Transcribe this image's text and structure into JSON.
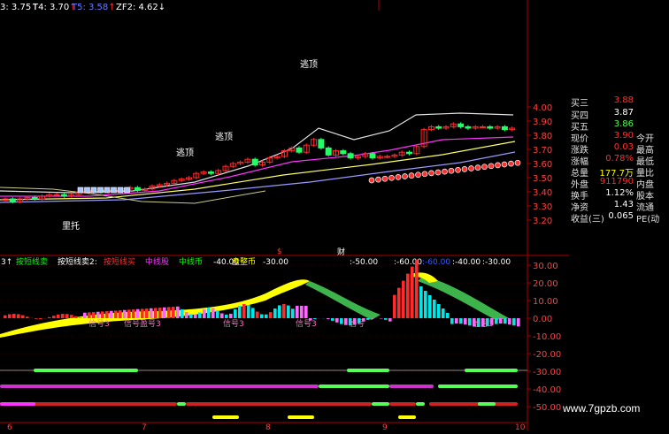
{
  "top_indicators": [
    {
      "text": "3: 3.75",
      "arrow": "↑",
      "color": "#ffffff",
      "arrow_color": "#ff3030"
    },
    {
      "text": "T4: 3.70",
      "arrow": "↑",
      "color": "#ffffff",
      "arrow_color": "#ff3030"
    },
    {
      "text": "T5: 3.58",
      "arrow": "↑",
      "color": "#6a7cff",
      "arrow_color": "#ff3030"
    },
    {
      "text": "ZF2: 4.62",
      "arrow": "↓",
      "color": "#ffffff",
      "arrow_color": "#ffffff"
    }
  ],
  "price_axis": [
    "4.00",
    "3.90",
    "3.80",
    "3.70",
    "3.60",
    "3.50",
    "3.40",
    "3.30",
    "3.20"
  ],
  "annotations": {
    "escape_top_1": "逃顶",
    "escape_top_2": "逃顶",
    "escape_top_3": "逃顶",
    "support": "里托"
  },
  "quote_panel": [
    {
      "label": "买三",
      "value": "3.88",
      "value_color": "#ff3030",
      "label2": ""
    },
    {
      "label": "买四",
      "value": "3.87",
      "value_color": "#ffffff",
      "label2": ""
    },
    {
      "label": "买五",
      "value": "3.86",
      "value_color": "#4cff4c",
      "label2": ""
    },
    {
      "label": "现价",
      "value": "3.90",
      "value_color": "#ff3030",
      "label2": "今开"
    },
    {
      "label": "涨跌",
      "value": "0.03",
      "value_color": "#ff3030",
      "label2": "最高"
    },
    {
      "label": "涨幅",
      "value": "0.78%",
      "value_color": "#ff3030",
      "label2": "最低"
    },
    {
      "label": "总量",
      "value": "177.7万",
      "value_color": "#ffff00",
      "label2": "量比"
    },
    {
      "label": "外盘",
      "value": "911790",
      "value_color": "#ff3030",
      "label2": "内盘"
    },
    {
      "label": "换手",
      "value": "1.12%",
      "value_color": "#ffffff",
      "label2": "股本"
    },
    {
      "label": "净资",
      "value": "1.43",
      "value_color": "#ffffff",
      "label2": "流通"
    },
    {
      "label": "收益(三)",
      "value": "0.065",
      "value_color": "#ffffff",
      "label2": "PE(动"
    }
  ],
  "indicator_header": [
    {
      "text": "3↑",
      "color": "#ffffff"
    },
    {
      "text": "按短线卖",
      "color": "#00ff00"
    },
    {
      "text": "按短线卖2:",
      "color": "#ffffff"
    },
    {
      "text": "按短线买",
      "color": "#ff3030"
    },
    {
      "text": "中线股",
      "color": "#ff33ff"
    },
    {
      "text": "中线币",
      "color": "#00ff00"
    },
    {
      "text": "-40.00",
      "color": "#ffffff"
    },
    {
      "text": "盘整币",
      "color": "#ffff00"
    },
    {
      "text": "-30.00",
      "color": "#ffffff"
    }
  ],
  "mid_labels": [
    {
      "text": "$",
      "color": "#ff3030"
    },
    {
      "text": "财",
      "color": "#ffffff"
    },
    {
      "text": ":-50.00",
      "color": "#ffffff"
    },
    {
      "text": ":-60.00",
      "color": "#ffffff"
    },
    {
      "text": ":-60.00",
      "color": "#3b5bff"
    },
    {
      "text": ":-40.00",
      "color": "#ffffff"
    },
    {
      "text": ":-30.00",
      "color": "#ffffff"
    }
  ],
  "osc_axis": [
    "30.00",
    "20.00",
    "10.00",
    "0.00",
    "-10.00",
    "-20.00",
    "-30.00",
    "-40.00",
    "-50.00"
  ],
  "signal_labels": [
    "信号3",
    "信号盈号3",
    "信号3",
    "信号3",
    "信号",
    "信号3"
  ],
  "x_axis_labels": [
    "6",
    "7",
    "8",
    "9",
    "10"
  ],
  "watermark": "www.7gpzb.com",
  "colors": {
    "bg": "#000000",
    "up": "#ff2a2a",
    "down": "#22ff66",
    "axis": "#b00000",
    "magenta": "#ff33ff",
    "yellow": "#ffff00",
    "cyan": "#00ffff"
  }
}
